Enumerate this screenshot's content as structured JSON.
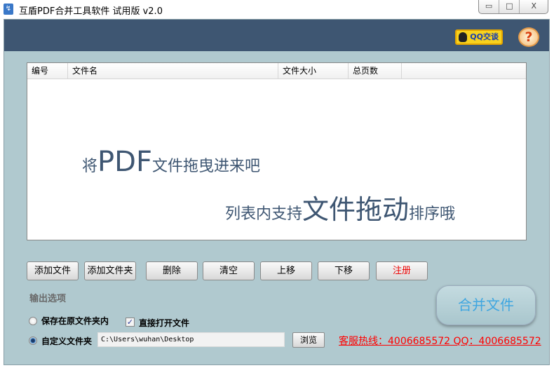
{
  "window": {
    "title": "互盾PDF合并工具软件 试用版 v2.0",
    "minimize": "▭",
    "maximize": "□",
    "close": "X"
  },
  "header": {
    "qq_chat": "QQ交谈",
    "help": "?"
  },
  "table": {
    "columns": [
      "编号",
      "文件名",
      "文件大小",
      "总页数"
    ],
    "rows": []
  },
  "dropzone": {
    "line1_pre": "将",
    "line1_big": "PDF",
    "line1_post": "文件拖曳进来吧",
    "line2_pre": "列表内支持",
    "line2_big": "文件拖动",
    "line2_post": "排序哦"
  },
  "buttons": {
    "add_file": "添加文件",
    "add_folder": "添加文件夹",
    "delete": "删除",
    "clear": "清空",
    "move_up": "上移",
    "move_down": "下移",
    "register": "注册",
    "merge": "合并文件",
    "browse": "浏览"
  },
  "output": {
    "title": "输出选项",
    "save_original": "保存在原文件夹内",
    "open_directly": "直接打开文件",
    "open_directly_checked": true,
    "custom_folder": "自定义文件夹",
    "selected": "custom_folder",
    "path": "C:\\Users\\wuhan\\Desktop"
  },
  "hotline": "客服热线：4006685572 QQ：4006685572"
}
